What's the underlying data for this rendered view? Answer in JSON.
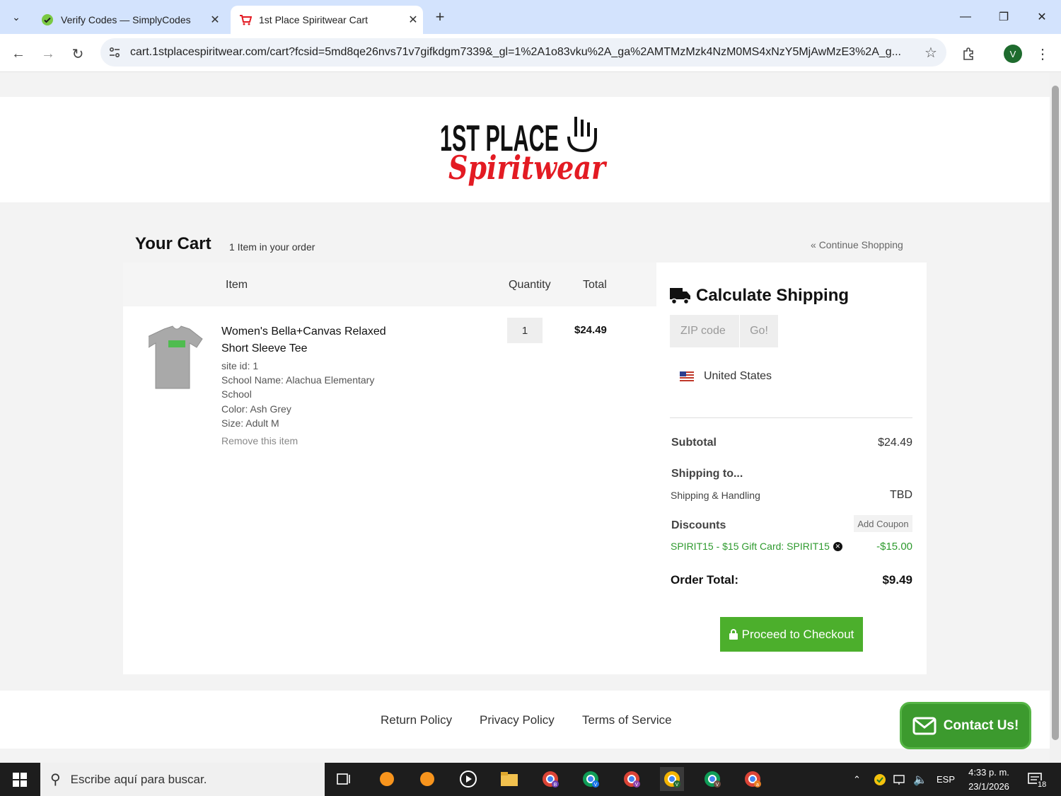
{
  "browser": {
    "tabs": [
      {
        "title": "Verify Codes — SimplyCodes",
        "active": false
      },
      {
        "title": "1st Place Spiritwear Cart",
        "active": true
      }
    ],
    "url": "cart.1stplacespiritwear.com/cart?fcsid=5md8qe26nvs71v7gifkdgm7339&_gl=1%2A1o83vku%2A_ga%2AMTMzMzk4NzM0MS4xNzY5MjAwMzE3%2A_g...",
    "profile_initial": "V"
  },
  "brand": {
    "logo_text_top": "1ST PLACE",
    "logo_text_bottom": "Spiritwear"
  },
  "cart": {
    "title": "Your Cart",
    "count_text": "1 Item in your order",
    "continue_label": "Continue Shopping",
    "columns": {
      "item": "Item",
      "quantity": "Quantity",
      "total": "Total"
    },
    "item": {
      "name": "Women's Bella+Canvas Relaxed Short Sleeve Tee",
      "site_id": "site id: 1",
      "school_name": "School Name: Alachua Elementary School",
      "color": "Color: Ash Grey",
      "size": "Size: Adult M",
      "remove_label": "Remove this item",
      "quantity": "1",
      "total": "$24.49"
    }
  },
  "shipping": {
    "title": "Calculate Shipping",
    "zip_placeholder": "ZIP code",
    "go_label": "Go!",
    "country": "United States"
  },
  "summary": {
    "subtotal_label": "Subtotal",
    "subtotal_value": "$24.49",
    "shipping_to_label": "Shipping to...",
    "shipping_handling_label": "Shipping & Handling",
    "shipping_handling_value": "TBD",
    "discounts_label": "Discounts",
    "add_coupon_label": "Add Coupon",
    "discount_text": "SPIRIT15 - $15 Gift Card: SPIRIT15",
    "discount_value": "-$15.00",
    "order_total_label": "Order Total:",
    "order_total_value": "$9.49",
    "checkout_label": "Proceed to Checkout"
  },
  "footer": {
    "links": [
      "Return Policy",
      "Privacy Policy",
      "Terms of Service"
    ],
    "contact_label": "Contact Us!"
  },
  "taskbar": {
    "search_placeholder": "Escribe aquí para buscar.",
    "language": "ESP",
    "time": "4:33 p. m.",
    "date": "23/1/2026",
    "notifications": "18",
    "app_badges": [
      "B",
      "V",
      "V",
      "V",
      "V",
      "a"
    ]
  },
  "colors": {
    "accent_green": "#4caf2c",
    "discount_green": "#2e9a2e",
    "brand_red": "#e31b23",
    "tab_strip": "#d3e3fd"
  }
}
